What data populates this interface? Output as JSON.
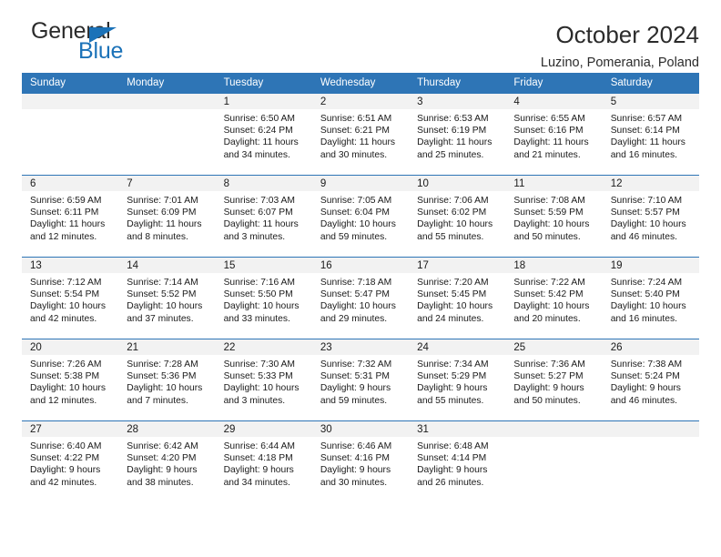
{
  "brand": {
    "name_part1": "General",
    "name_part2": "Blue",
    "accent_color": "#1b72b8"
  },
  "header": {
    "title": "October 2024",
    "subtitle": "Luzino, Pomerania, Poland",
    "header_color": "#2e75b6"
  },
  "labels": {
    "sunrise_prefix": "Sunrise:",
    "sunset_prefix": "Sunset:",
    "daylight_prefix": "Daylight:"
  },
  "weekdays": [
    "Sunday",
    "Monday",
    "Tuesday",
    "Wednesday",
    "Thursday",
    "Friday",
    "Saturday"
  ],
  "weeks": [
    [
      {
        "day": ""
      },
      {
        "day": ""
      },
      {
        "day": "1",
        "sunrise": "Sunrise: 6:50 AM",
        "sunset": "Sunset: 6:24 PM",
        "daylight": "Daylight: 11 hours and 34 minutes."
      },
      {
        "day": "2",
        "sunrise": "Sunrise: 6:51 AM",
        "sunset": "Sunset: 6:21 PM",
        "daylight": "Daylight: 11 hours and 30 minutes."
      },
      {
        "day": "3",
        "sunrise": "Sunrise: 6:53 AM",
        "sunset": "Sunset: 6:19 PM",
        "daylight": "Daylight: 11 hours and 25 minutes."
      },
      {
        "day": "4",
        "sunrise": "Sunrise: 6:55 AM",
        "sunset": "Sunset: 6:16 PM",
        "daylight": "Daylight: 11 hours and 21 minutes."
      },
      {
        "day": "5",
        "sunrise": "Sunrise: 6:57 AM",
        "sunset": "Sunset: 6:14 PM",
        "daylight": "Daylight: 11 hours and 16 minutes."
      }
    ],
    [
      {
        "day": "6",
        "sunrise": "Sunrise: 6:59 AM",
        "sunset": "Sunset: 6:11 PM",
        "daylight": "Daylight: 11 hours and 12 minutes."
      },
      {
        "day": "7",
        "sunrise": "Sunrise: 7:01 AM",
        "sunset": "Sunset: 6:09 PM",
        "daylight": "Daylight: 11 hours and 8 minutes."
      },
      {
        "day": "8",
        "sunrise": "Sunrise: 7:03 AM",
        "sunset": "Sunset: 6:07 PM",
        "daylight": "Daylight: 11 hours and 3 minutes."
      },
      {
        "day": "9",
        "sunrise": "Sunrise: 7:05 AM",
        "sunset": "Sunset: 6:04 PM",
        "daylight": "Daylight: 10 hours and 59 minutes."
      },
      {
        "day": "10",
        "sunrise": "Sunrise: 7:06 AM",
        "sunset": "Sunset: 6:02 PM",
        "daylight": "Daylight: 10 hours and 55 minutes."
      },
      {
        "day": "11",
        "sunrise": "Sunrise: 7:08 AM",
        "sunset": "Sunset: 5:59 PM",
        "daylight": "Daylight: 10 hours and 50 minutes."
      },
      {
        "day": "12",
        "sunrise": "Sunrise: 7:10 AM",
        "sunset": "Sunset: 5:57 PM",
        "daylight": "Daylight: 10 hours and 46 minutes."
      }
    ],
    [
      {
        "day": "13",
        "sunrise": "Sunrise: 7:12 AM",
        "sunset": "Sunset: 5:54 PM",
        "daylight": "Daylight: 10 hours and 42 minutes."
      },
      {
        "day": "14",
        "sunrise": "Sunrise: 7:14 AM",
        "sunset": "Sunset: 5:52 PM",
        "daylight": "Daylight: 10 hours and 37 minutes."
      },
      {
        "day": "15",
        "sunrise": "Sunrise: 7:16 AM",
        "sunset": "Sunset: 5:50 PM",
        "daylight": "Daylight: 10 hours and 33 minutes."
      },
      {
        "day": "16",
        "sunrise": "Sunrise: 7:18 AM",
        "sunset": "Sunset: 5:47 PM",
        "daylight": "Daylight: 10 hours and 29 minutes."
      },
      {
        "day": "17",
        "sunrise": "Sunrise: 7:20 AM",
        "sunset": "Sunset: 5:45 PM",
        "daylight": "Daylight: 10 hours and 24 minutes."
      },
      {
        "day": "18",
        "sunrise": "Sunrise: 7:22 AM",
        "sunset": "Sunset: 5:42 PM",
        "daylight": "Daylight: 10 hours and 20 minutes."
      },
      {
        "day": "19",
        "sunrise": "Sunrise: 7:24 AM",
        "sunset": "Sunset: 5:40 PM",
        "daylight": "Daylight: 10 hours and 16 minutes."
      }
    ],
    [
      {
        "day": "20",
        "sunrise": "Sunrise: 7:26 AM",
        "sunset": "Sunset: 5:38 PM",
        "daylight": "Daylight: 10 hours and 12 minutes."
      },
      {
        "day": "21",
        "sunrise": "Sunrise: 7:28 AM",
        "sunset": "Sunset: 5:36 PM",
        "daylight": "Daylight: 10 hours and 7 minutes."
      },
      {
        "day": "22",
        "sunrise": "Sunrise: 7:30 AM",
        "sunset": "Sunset: 5:33 PM",
        "daylight": "Daylight: 10 hours and 3 minutes."
      },
      {
        "day": "23",
        "sunrise": "Sunrise: 7:32 AM",
        "sunset": "Sunset: 5:31 PM",
        "daylight": "Daylight: 9 hours and 59 minutes."
      },
      {
        "day": "24",
        "sunrise": "Sunrise: 7:34 AM",
        "sunset": "Sunset: 5:29 PM",
        "daylight": "Daylight: 9 hours and 55 minutes."
      },
      {
        "day": "25",
        "sunrise": "Sunrise: 7:36 AM",
        "sunset": "Sunset: 5:27 PM",
        "daylight": "Daylight: 9 hours and 50 minutes."
      },
      {
        "day": "26",
        "sunrise": "Sunrise: 7:38 AM",
        "sunset": "Sunset: 5:24 PM",
        "daylight": "Daylight: 9 hours and 46 minutes."
      }
    ],
    [
      {
        "day": "27",
        "sunrise": "Sunrise: 6:40 AM",
        "sunset": "Sunset: 4:22 PM",
        "daylight": "Daylight: 9 hours and 42 minutes."
      },
      {
        "day": "28",
        "sunrise": "Sunrise: 6:42 AM",
        "sunset": "Sunset: 4:20 PM",
        "daylight": "Daylight: 9 hours and 38 minutes."
      },
      {
        "day": "29",
        "sunrise": "Sunrise: 6:44 AM",
        "sunset": "Sunset: 4:18 PM",
        "daylight": "Daylight: 9 hours and 34 minutes."
      },
      {
        "day": "30",
        "sunrise": "Sunrise: 6:46 AM",
        "sunset": "Sunset: 4:16 PM",
        "daylight": "Daylight: 9 hours and 30 minutes."
      },
      {
        "day": "31",
        "sunrise": "Sunrise: 6:48 AM",
        "sunset": "Sunset: 4:14 PM",
        "daylight": "Daylight: 9 hours and 26 minutes."
      },
      {
        "day": ""
      },
      {
        "day": ""
      }
    ]
  ]
}
